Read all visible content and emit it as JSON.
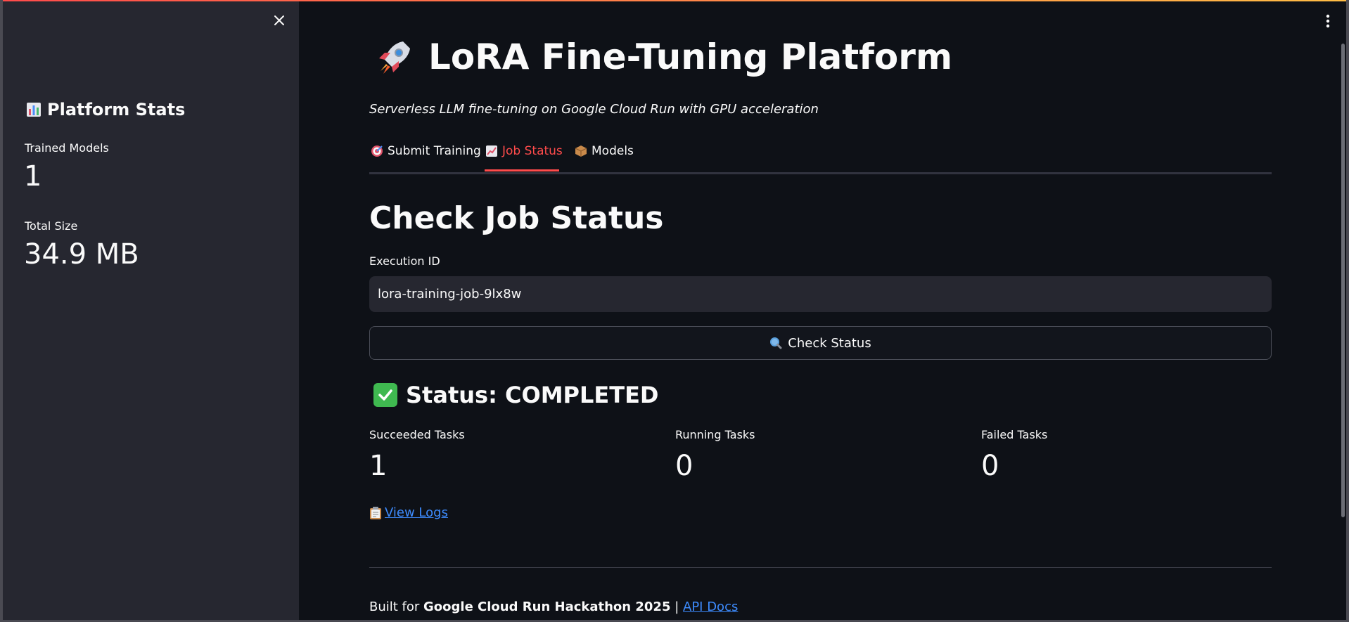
{
  "sidebar": {
    "header_icon": "bar-chart-icon",
    "header": "Platform Stats",
    "metrics": [
      {
        "label": "Trained Models",
        "value": "1"
      },
      {
        "label": "Total Size",
        "value": "34.9 MB"
      }
    ]
  },
  "main": {
    "title_icon": "rocket-icon",
    "title": "LoRA Fine-Tuning Platform",
    "subtitle": "Serverless LLM fine-tuning on Google Cloud Run with GPU acceleration",
    "tabs": [
      {
        "icon": "target-icon",
        "label": "Submit Training",
        "active": false
      },
      {
        "icon": "chart-up-icon",
        "label": "Job Status",
        "active": true
      },
      {
        "icon": "package-icon",
        "label": "Models",
        "active": false
      }
    ],
    "section_title": "Check Job Status",
    "execution_id_label": "Execution ID",
    "execution_id_value": "lora-training-job-9lx8w",
    "check_button_label": "Check Status",
    "status_text": "Status: COMPLETED",
    "metrics": [
      {
        "label": "Succeeded Tasks",
        "value": "1"
      },
      {
        "label": "Running Tasks",
        "value": "0"
      },
      {
        "label": "Failed Tasks",
        "value": "0"
      }
    ],
    "view_logs_label": "View Logs",
    "footer": {
      "prefix": "Built for ",
      "bold": "Google Cloud Run Hackathon 2025",
      "separator": " | ",
      "link": "API Docs"
    }
  },
  "colors": {
    "background": "#0e1117",
    "sidebar": "#262730",
    "accent": "#ff4b4b",
    "link": "#3d8bfd",
    "success": "#3fb950"
  }
}
